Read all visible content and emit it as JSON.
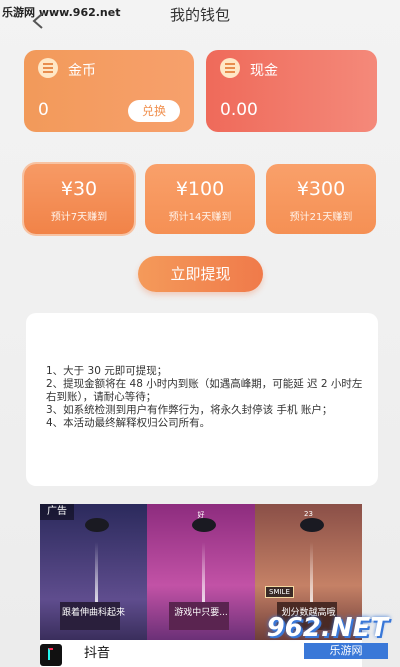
{
  "watermark": {
    "site": "乐游网 www.962.net"
  },
  "header": {
    "title": "我的钱包"
  },
  "wallet": {
    "coin": {
      "label": "金币",
      "value": "0",
      "exchange_label": "兑换"
    },
    "cash": {
      "label": "现金",
      "value": "0.00"
    }
  },
  "amounts": [
    {
      "value": "¥30",
      "note": "预计7天赚到"
    },
    {
      "value": "¥100",
      "note": "预计14天赚到"
    },
    {
      "value": "¥300",
      "note": "预计21天赚到"
    }
  ],
  "withdraw_label": "立即提现",
  "rules": [
    "1、大于 30 元即可提现；",
    "2、提现金额将在 48 小时内到账（如遇高峰期，可能延 迟 2 小时左右到账），请耐心等待；",
    "3、如系统检测到用户有作弊行为，将永久封停该 手机 账户；",
    "4、本活动最终解释权归公司所有。"
  ],
  "ad": {
    "tag": "广告",
    "panels": [
      {
        "caption": "跟着伸曲科起来"
      },
      {
        "caption": "游戏中只要...",
        "number": "好"
      },
      {
        "caption": "划分数越高哦",
        "number": "23"
      }
    ],
    "smile": "SMILE",
    "app_name": "抖音"
  },
  "corner_watermark": {
    "big": "962.NET",
    "small": "乐游网"
  }
}
